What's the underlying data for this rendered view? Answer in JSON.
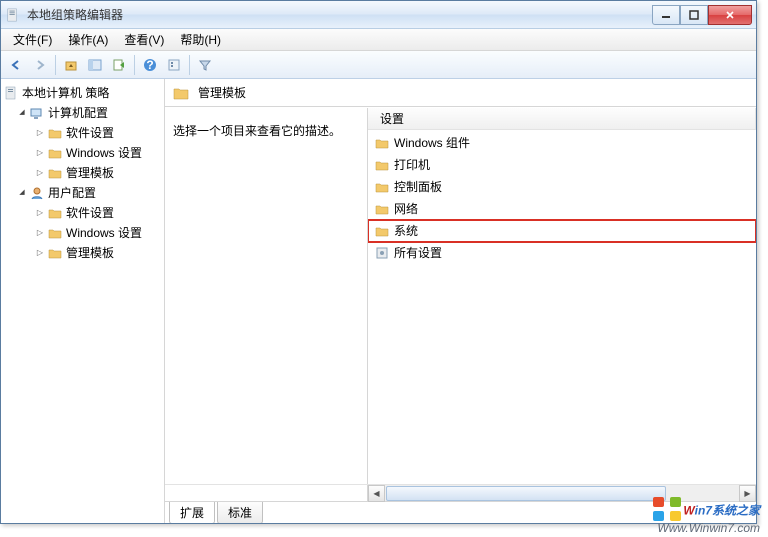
{
  "window": {
    "title": "本地组策略编辑器"
  },
  "menu": {
    "file": "文件(F)",
    "action": "操作(A)",
    "view": "查看(V)",
    "help": "帮助(H)"
  },
  "tree": {
    "root": "本地计算机 策略",
    "computer": "计算机配置",
    "c_soft": "软件设置",
    "c_win": "Windows 设置",
    "c_tpl": "管理模板",
    "user": "用户配置",
    "u_soft": "软件设置",
    "u_win": "Windows 设置",
    "u_tpl": "管理模板"
  },
  "content": {
    "header": "管理模板",
    "prompt": "选择一个项目来查看它的描述。",
    "col_setting": "设置",
    "items": {
      "win_comp": "Windows 组件",
      "printer": "打印机",
      "cpanel": "控制面板",
      "network": "网络",
      "system": "系统",
      "all": "所有设置"
    }
  },
  "tabs": {
    "extended": "扩展",
    "standard": "标准"
  },
  "watermark": {
    "brand_a": "W",
    "brand_b": "in7",
    "brand_c": "系统之家",
    "url": "Www.Winwin7.com"
  }
}
